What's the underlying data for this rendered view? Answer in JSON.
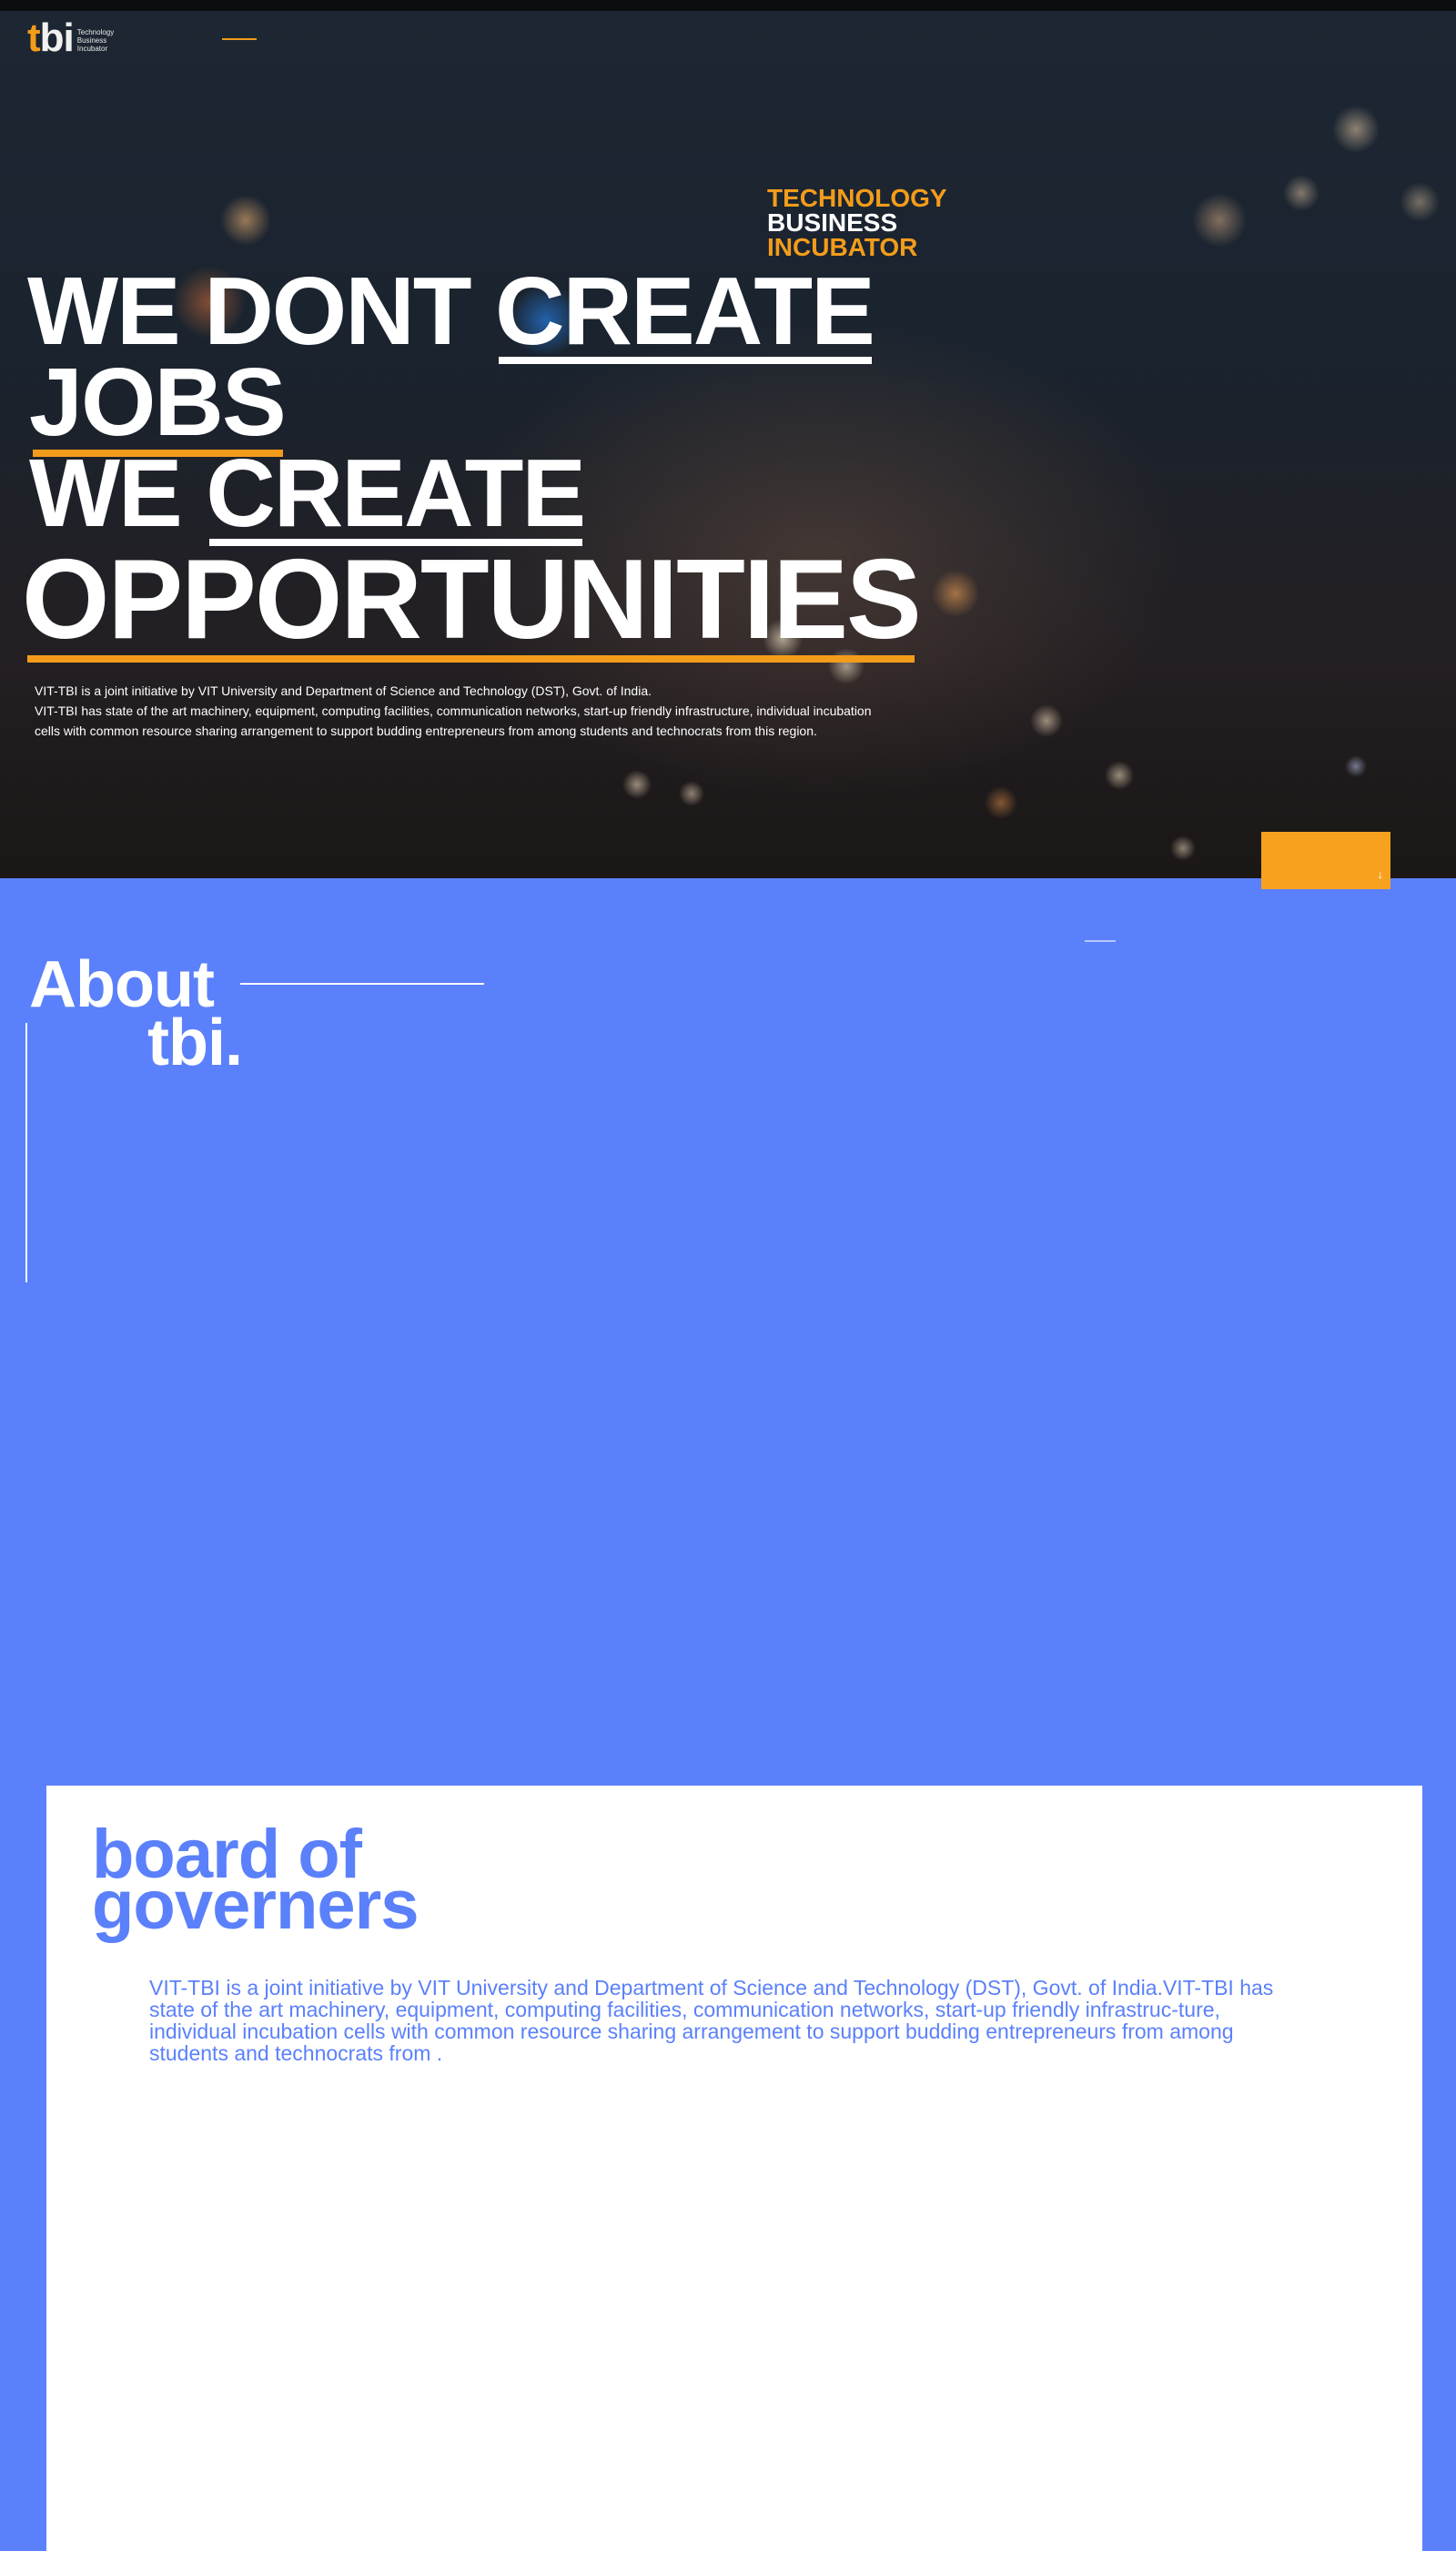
{
  "logo": {
    "mark_t": "t",
    "mark_bi": "bi",
    "sub": [
      "Technology",
      "Business",
      "Incubator"
    ]
  },
  "hero": {
    "tbi_words": [
      "TECHNOLOGY",
      "BUSINESS",
      "INCUBATOR"
    ],
    "headline": {
      "line1_a": "WE DONT",
      "line1_b": "CREATE",
      "line2": "JOBS",
      "line3_a": "WE",
      "line3_b": "CREATE",
      "line4": "OPPORTUNITIES"
    },
    "desc_line1": "VIT-TBI is a joint initiative by VIT University and Department of Science and Technology (DST), Govt. of India.",
    "desc_line2": "VIT-TBI has state of the art machinery, equipment, computing facilities, communication networks, start-up friendly infrastructure, individual incubation",
    "desc_line3": "cells with common resource sharing arrangement to support budding entrepreneurs from among students and technocrats from this region.",
    "scroll_icon": "arrow-down-icon",
    "scroll_glyph": "↓"
  },
  "about": {
    "title_line1": "About",
    "title_line2": "tbi."
  },
  "board": {
    "title_line1": "board of",
    "title_line2": "governers",
    "desc": "VIT-TBI is a joint initiative by VIT University and Department of Science and Technology (DST), Govt. of India.VIT-TBI has state of the art machinery, equipment, computing facilities, communication networks, start-up friendly infrastruc-ture, individual incubation cells with common resource sharing arrangement to support budding entrepreneurs from among students and technocrats from ."
  },
  "colors": {
    "accent_orange": "#f39c1b",
    "page_blue": "#5b80fb",
    "white": "#ffffff"
  }
}
